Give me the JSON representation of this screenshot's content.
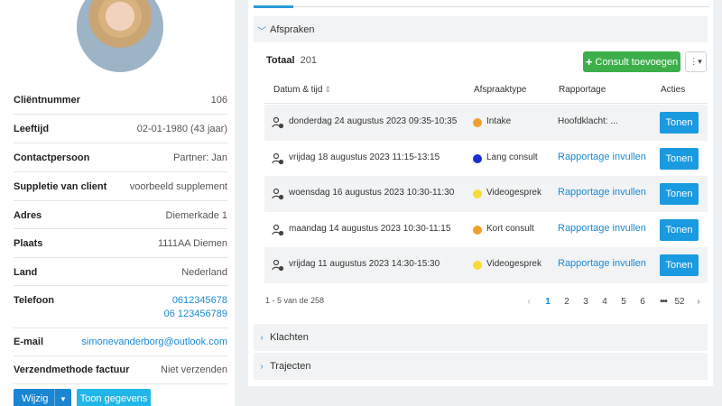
{
  "client": {
    "rows": [
      {
        "label": "Cliëntnummer",
        "value": "106"
      },
      {
        "label": "Leeftijd",
        "value": "02-01-1980 (43 jaar)"
      },
      {
        "label": "Contactpersoon",
        "value": "Partner: Jan"
      },
      {
        "label": "Suppletie van client",
        "value": "voorbeeld supplement"
      },
      {
        "label": "Adres",
        "value": "Diemerkade 1"
      },
      {
        "label": "Plaats",
        "value": "1111AA Diemen"
      },
      {
        "label": "Land",
        "value": "Nederland"
      }
    ],
    "telefoon": {
      "label": "Telefoon",
      "value1": "0612345678",
      "value2": "06 123456789"
    },
    "email": {
      "label": "E-mail",
      "value": "simonevanderborg@outlook.com"
    },
    "verzend": {
      "label": "Verzendmethode factuur",
      "value": "Niet verzenden"
    },
    "buttons": {
      "wijzig": "Wijzig",
      "toon": "Toon gegevens"
    }
  },
  "sections": {
    "afspraken": "Afspraken",
    "klachten": "Klachten",
    "trajecten": "Trajecten"
  },
  "afspraken": {
    "totaal_label": "Totaal",
    "totaal_value": "201",
    "add_button": "Consult toevoegen",
    "headers": {
      "datum": "Datum & tijd",
      "type": "Afspraaktype",
      "rapportage": "Rapportage",
      "acties": "Acties"
    },
    "rows": [
      {
        "date": "donderdag 24 augustus 2023 09:35-10:35",
        "type": "Intake",
        "color": "#f0a030",
        "rapportage": "Hoofdklacht: ...",
        "link": false,
        "action": "Tonen"
      },
      {
        "date": "vrijdag 18 augustus 2023 11:15-13:15",
        "type": "Lang consult",
        "color": "#1a2fd0",
        "rapportage": "Rapportage invullen",
        "link": true,
        "action": "Tonen"
      },
      {
        "date": "woensdag 16 augustus 2023 10:30-11:30",
        "type": "Videogesprek",
        "color": "#f5dc3a",
        "rapportage": "Rapportage invullen",
        "link": true,
        "action": "Tonen"
      },
      {
        "date": "maandag 14 augustus 2023 10:30-11:15",
        "type": "Kort consult",
        "color": "#f0a030",
        "rapportage": "Rapportage invullen",
        "link": true,
        "action": "Tonen"
      },
      {
        "date": "vrijdag 11 augustus 2023 14:30-15:30",
        "type": "Videogesprek",
        "color": "#f5dc3a",
        "rapportage": "Rapportage invullen",
        "link": true,
        "action": "Tonen"
      }
    ],
    "pager_info": "1 - 5 van de 258",
    "pages": [
      "1",
      "2",
      "3",
      "4",
      "5",
      "6",
      "•••",
      "52"
    ]
  }
}
